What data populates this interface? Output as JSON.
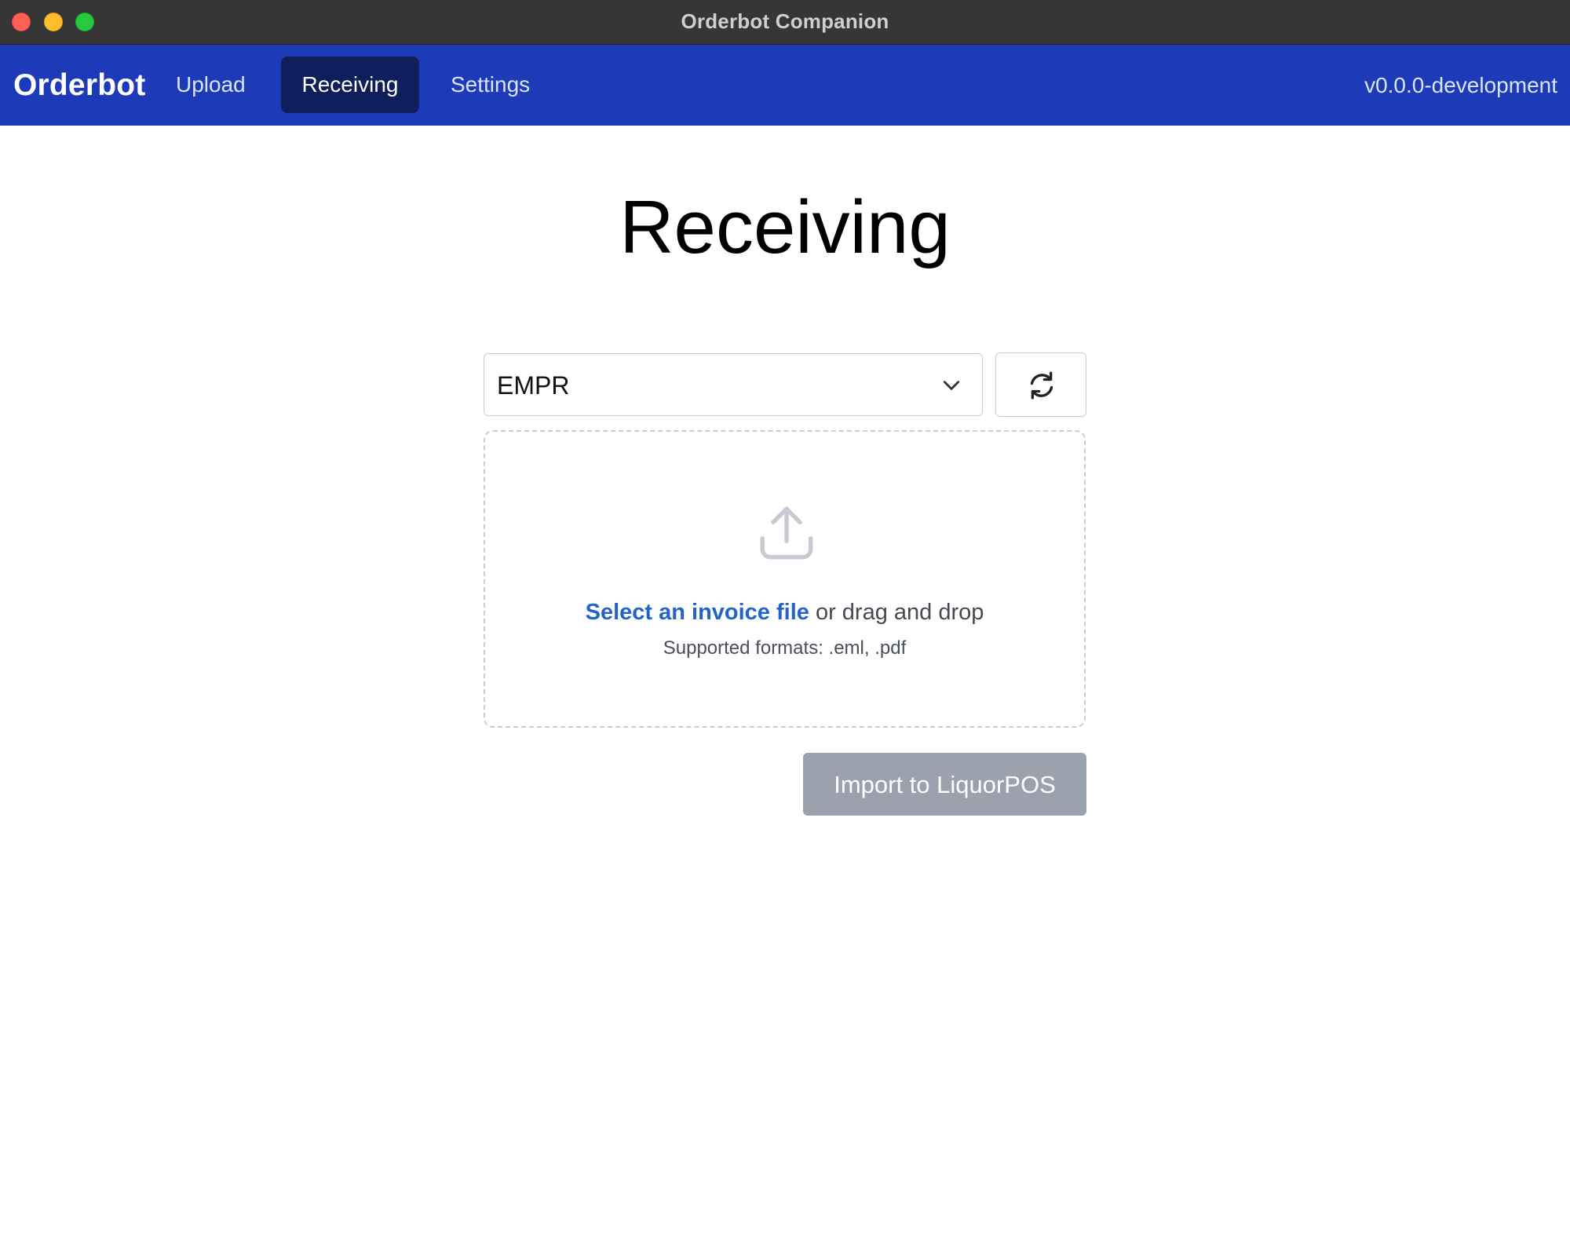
{
  "window": {
    "title": "Orderbot Companion"
  },
  "navbar": {
    "brand": "Orderbot",
    "links": [
      {
        "label": "Upload",
        "active": false
      },
      {
        "label": "Receiving",
        "active": true
      },
      {
        "label": "Settings",
        "active": false
      }
    ],
    "version": "v0.0.0-development"
  },
  "page": {
    "title": "Receiving"
  },
  "vendor_select": {
    "selected": "EMPR",
    "icon": "chevron-down-icon"
  },
  "refresh_button": {
    "icon": "refresh-icon"
  },
  "dropzone": {
    "icon": "upload-icon",
    "select_link": "Select an invoice file",
    "drag_text": " or drag and drop",
    "formats": "Supported formats: .eml, .pdf"
  },
  "import_button": {
    "label": "Import to LiquorPOS",
    "disabled": true
  },
  "colors": {
    "navbar": "#1d3bb8",
    "nav_active": "#0f1f5c",
    "link": "#2463c9",
    "disabled_button": "#9ba2ae"
  }
}
